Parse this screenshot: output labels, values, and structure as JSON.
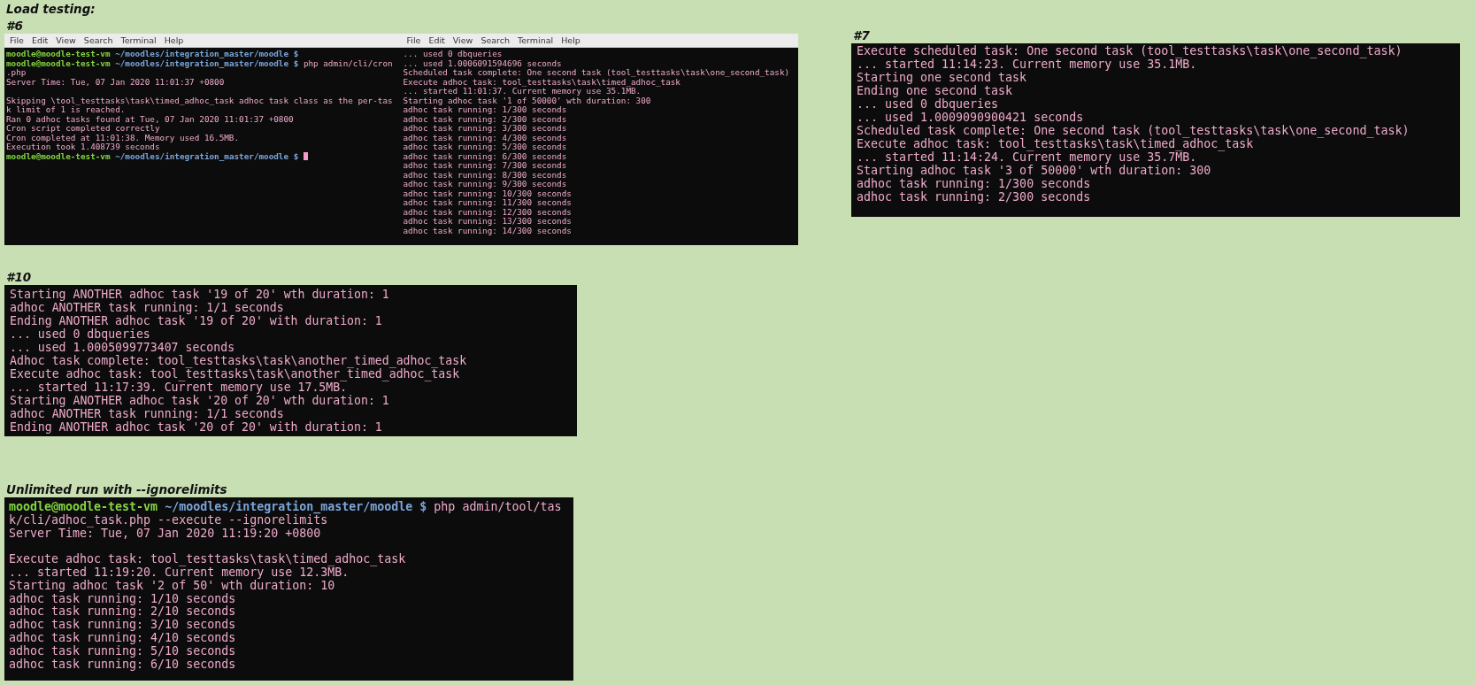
{
  "page_title": "Load testing:",
  "sections": [
    {
      "heading": "#6",
      "terminals": [
        {
          "menu": [
            "File",
            "Edit",
            "View",
            "Search",
            "Terminal",
            "Help"
          ],
          "lines": [
            {
              "kind": "prompt",
              "user": "moodle@moodle-test-vm",
              "path": "~/moodles/integration_master/moodle $",
              "cursor": false
            },
            {
              "kind": "prompt",
              "user": "moodle@moodle-test-vm",
              "path": "~/moodles/integration_master/moodle $",
              "command": "php admin/cli/cron",
              "cursor": false
            },
            {
              "kind": "output",
              "text": ".php"
            },
            {
              "kind": "output",
              "text": "Server Time: Tue, 07 Jan 2020 11:01:37 +0800"
            },
            {
              "kind": "gap"
            },
            {
              "kind": "output",
              "text": "Skipping \\tool_testtasks\\task\\timed_adhoc_task adhoc task class as the per-tas"
            },
            {
              "kind": "output",
              "text": "k limit of 1 is reached."
            },
            {
              "kind": "output",
              "text": "Ran 0 adhoc tasks found at Tue, 07 Jan 2020 11:01:37 +0800"
            },
            {
              "kind": "output",
              "text": "Cron script completed correctly"
            },
            {
              "kind": "output",
              "text": "Cron completed at 11:01:38. Memory used 16.5MB."
            },
            {
              "kind": "output",
              "text": "Execution took 1.408739 seconds"
            },
            {
              "kind": "prompt",
              "user": "moodle@moodle-test-vm",
              "path": "~/moodles/integration_master/moodle $",
              "cursor": true
            }
          ]
        },
        {
          "menu": [
            "File",
            "Edit",
            "View",
            "Search",
            "Terminal",
            "Help"
          ],
          "lines": [
            {
              "kind": "output",
              "text": "... used 0 dbqueries"
            },
            {
              "kind": "output",
              "text": "... used 1.0006091594696 seconds"
            },
            {
              "kind": "output",
              "text": "Scheduled task complete: One second task (tool_testtasks\\task\\one_second_task)"
            },
            {
              "kind": "output",
              "text": "Execute adhoc task: tool_testtasks\\task\\timed_adhoc_task"
            },
            {
              "kind": "output",
              "text": "... started 11:01:37. Current memory use 35.1MB."
            },
            {
              "kind": "output",
              "text": "Starting adhoc task '1 of 50000' wth duration: 300"
            },
            {
              "kind": "output",
              "text": "adhoc task running: 1/300 seconds"
            },
            {
              "kind": "output",
              "text": "adhoc task running: 2/300 seconds"
            },
            {
              "kind": "output",
              "text": "adhoc task running: 3/300 seconds"
            },
            {
              "kind": "output",
              "text": "adhoc task running: 4/300 seconds"
            },
            {
              "kind": "output",
              "text": "adhoc task running: 5/300 seconds"
            },
            {
              "kind": "output",
              "text": "adhoc task running: 6/300 seconds"
            },
            {
              "kind": "output",
              "text": "adhoc task running: 7/300 seconds"
            },
            {
              "kind": "output",
              "text": "adhoc task running: 8/300 seconds"
            },
            {
              "kind": "output",
              "text": "adhoc task running: 9/300 seconds"
            },
            {
              "kind": "output",
              "text": "adhoc task running: 10/300 seconds"
            },
            {
              "kind": "output",
              "text": "adhoc task running: 11/300 seconds"
            },
            {
              "kind": "output",
              "text": "adhoc task running: 12/300 seconds"
            },
            {
              "kind": "output",
              "text": "adhoc task running: 13/300 seconds"
            },
            {
              "kind": "output",
              "text": "adhoc task running: 14/300 seconds"
            }
          ]
        }
      ]
    },
    {
      "heading": "#7",
      "terminals": [
        {
          "lines": [
            {
              "kind": "output",
              "text": "Execute scheduled task: One second task (tool_testtasks\\task\\one_second_task)"
            },
            {
              "kind": "output",
              "text": "... started 11:14:23. Current memory use 35.1MB."
            },
            {
              "kind": "output",
              "text": "Starting one second task"
            },
            {
              "kind": "output",
              "text": "Ending one second task"
            },
            {
              "kind": "output",
              "text": "... used 0 dbqueries"
            },
            {
              "kind": "output",
              "text": "... used 1.0009090900421 seconds"
            },
            {
              "kind": "output",
              "text": "Scheduled task complete: One second task (tool_testtasks\\task\\one_second_task)"
            },
            {
              "kind": "output",
              "text": "Execute adhoc task: tool_testtasks\\task\\timed_adhoc_task"
            },
            {
              "kind": "output",
              "text": "... started 11:14:24. Current memory use 35.7MB."
            },
            {
              "kind": "output",
              "text": "Starting adhoc task '3 of 50000' wth duration: 300"
            },
            {
              "kind": "output",
              "text": "adhoc task running: 1/300 seconds"
            },
            {
              "kind": "output",
              "text": "adhoc task running: 2/300 seconds"
            }
          ]
        }
      ]
    },
    {
      "heading": "#10",
      "terminals": [
        {
          "lines": [
            {
              "kind": "output",
              "text": "Starting ANOTHER adhoc task '19 of 20' wth duration: 1"
            },
            {
              "kind": "output",
              "text": "adhoc ANOTHER task running: 1/1 seconds"
            },
            {
              "kind": "output",
              "text": "Ending ANOTHER adhoc task '19 of 20' with duration: 1"
            },
            {
              "kind": "output",
              "text": "... used 0 dbqueries"
            },
            {
              "kind": "output",
              "text": "... used 1.0005099773407 seconds"
            },
            {
              "kind": "output",
              "text": "Adhoc task complete: tool_testtasks\\task\\another_timed_adhoc_task"
            },
            {
              "kind": "output",
              "text": "Execute adhoc task: tool_testtasks\\task\\another_timed_adhoc_task"
            },
            {
              "kind": "output",
              "text": "... started 11:17:39. Current memory use 17.5MB."
            },
            {
              "kind": "output",
              "text": "Starting ANOTHER adhoc task '20 of 20' wth duration: 1"
            },
            {
              "kind": "output",
              "text": "adhoc ANOTHER task running: 1/1 seconds"
            },
            {
              "kind": "output",
              "text": "Ending ANOTHER adhoc task '20 of 20' with duration: 1"
            }
          ]
        }
      ]
    },
    {
      "heading": "Unlimited run with --ignorelimits",
      "terminals": [
        {
          "lines": [
            {
              "kind": "prompt",
              "user": "moodle@moodle-test-vm",
              "path": "~/moodles/integration_master/moodle $",
              "command": "php admin/tool/tas",
              "cursor": false
            },
            {
              "kind": "output",
              "text": "k/cli/adhoc_task.php --execute --ignorelimits"
            },
            {
              "kind": "output",
              "text": "Server Time: Tue, 07 Jan 2020 11:19:20 +0800"
            },
            {
              "kind": "gap"
            },
            {
              "kind": "output",
              "text": "Execute adhoc task: tool_testtasks\\task\\timed_adhoc_task"
            },
            {
              "kind": "output",
              "text": "... started 11:19:20. Current memory use 12.3MB."
            },
            {
              "kind": "output",
              "text": "Starting adhoc task '2 of 50' wth duration: 10"
            },
            {
              "kind": "output",
              "text": "adhoc task running: 1/10 seconds"
            },
            {
              "kind": "output",
              "text": "adhoc task running: 2/10 seconds"
            },
            {
              "kind": "output",
              "text": "adhoc task running: 3/10 seconds"
            },
            {
              "kind": "output",
              "text": "adhoc task running: 4/10 seconds"
            },
            {
              "kind": "output",
              "text": "adhoc task running: 5/10 seconds"
            },
            {
              "kind": "output",
              "text": "adhoc task running: 6/10 seconds"
            }
          ]
        }
      ]
    }
  ]
}
